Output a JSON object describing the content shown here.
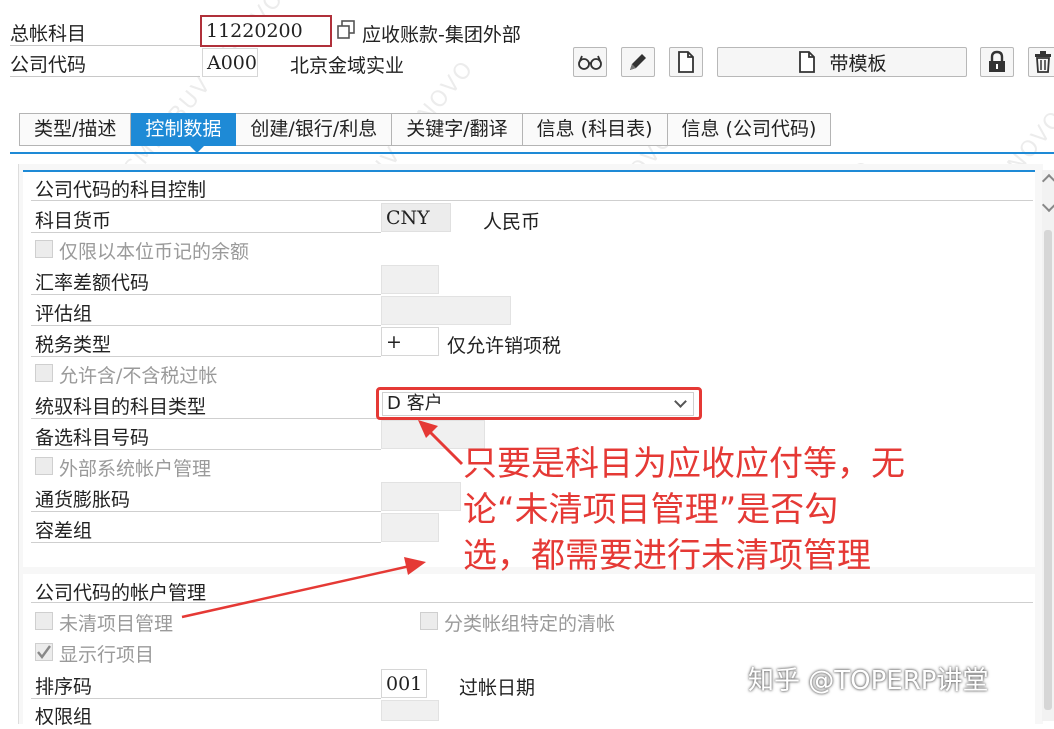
{
  "header": {
    "gl_account_label": "总帐科目",
    "gl_account_value": "11220200",
    "gl_account_desc": "应收账款-集团外部",
    "company_code_label": "公司代码",
    "company_code_value": "A000",
    "company_code_name": "北京金域实业",
    "template_button": "带模板"
  },
  "icons": {
    "copy": "copy-icon",
    "glasses": "display-glasses-icon",
    "pencil": "edit-pencil-icon",
    "new_doc": "new-document-icon",
    "lock": "lock-icon",
    "trash": "delete-trash-icon"
  },
  "tabs": [
    {
      "label": "类型/描述"
    },
    {
      "label": "控制数据"
    },
    {
      "label": "创建/银行/利息"
    },
    {
      "label": "关键字/翻译"
    },
    {
      "label": "信息 (科目表)"
    },
    {
      "label": "信息 (公司代码)"
    }
  ],
  "section1": {
    "title": "公司代码的科目控制",
    "currency_label": "科目货币",
    "currency_value": "CNY",
    "currency_desc": "人民币",
    "local_only_label": "仅限以本位币记的余额",
    "fx_diff_label": "汇率差额代码",
    "valuation_label": "评估组",
    "tax_cat_label": "税务类型",
    "tax_cat_value": "+",
    "tax_cat_desc": "仅允许销项税",
    "no_tax_post_label": "允许含/不含税过帐",
    "recon_label": "统驭科目的科目类型",
    "recon_value": "D 客户",
    "alt_account_label": "备选科目号码",
    "ext_system_label": "外部系统帐户管理",
    "inflation_label": "通货膨胀码",
    "tolerance_label": "容差组"
  },
  "section2": {
    "title": "公司代码的帐户管理",
    "open_item_label": "未清项目管理",
    "ledger_group_label": "分类帐组特定的清帐",
    "line_items_label": "显示行项目",
    "sort_key_label": "排序码",
    "sort_key_value": "001",
    "sort_key_desc": "过帐日期",
    "auth_group_label": "权限组"
  },
  "annotation": {
    "line1": "只要是科目为应收应付等，无",
    "line2": "论“未清项目管理”是否勾",
    "line3": "选，都需要进行未清项管理"
  },
  "footer_watermark": "知乎 @TOPERP讲堂",
  "watermark_text": "LAPTOP-KCMDLBUV  LENOVO",
  "colors": {
    "tab_active": "#1e8ad6",
    "annotation_red": "#e53935"
  }
}
